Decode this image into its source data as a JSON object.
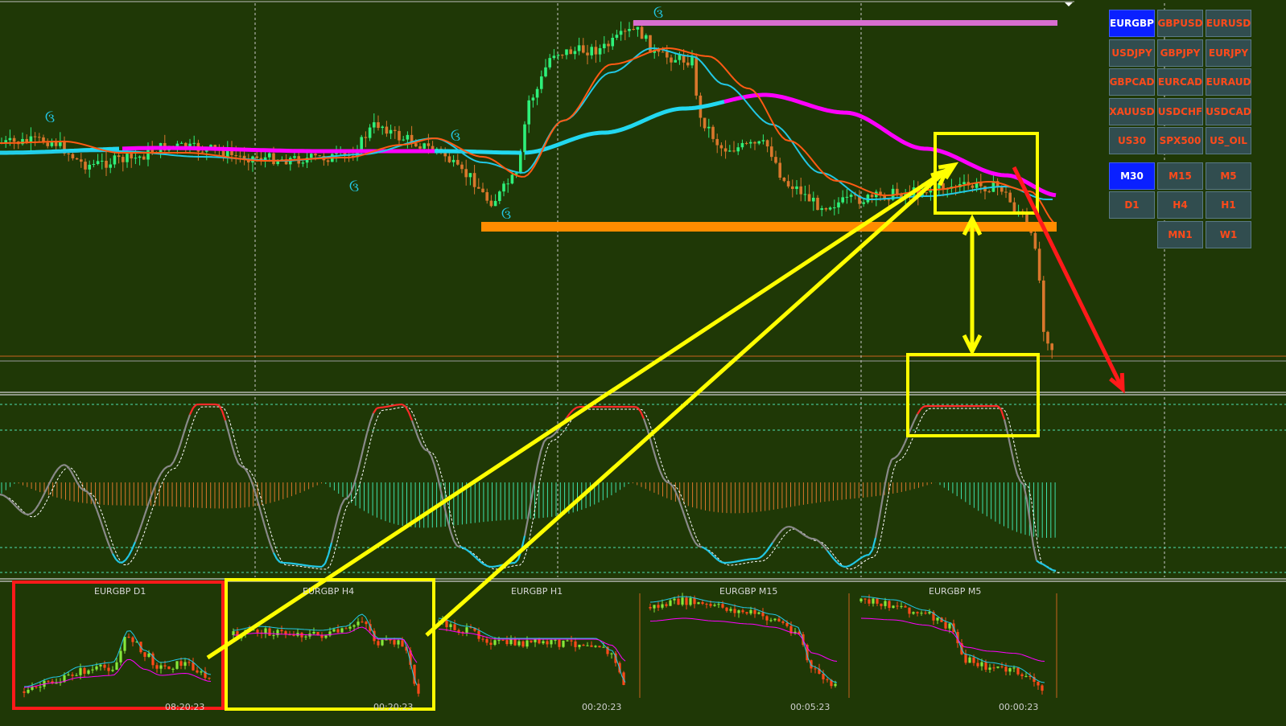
{
  "symbols": [
    "EURGBP",
    "GBPUSD",
    "EURUSD",
    "USDJPY",
    "GBPJPY",
    "EURJPY",
    "GBPCAD",
    "EURCAD",
    "EURAUD",
    "XAUUSD",
    "USDCHF",
    "USDCAD",
    "US30",
    "SPX500",
    "US_OIL"
  ],
  "active_symbol": "EURGBP",
  "timeframes": [
    "M30",
    "M15",
    "M5",
    "D1",
    "H4",
    "H1",
    "MN1",
    "W1"
  ],
  "active_timeframe": "M30",
  "mini_charts": [
    {
      "title": "EURGBP D1",
      "time": "08:20:23"
    },
    {
      "title": "EURGBP H4",
      "time": "00:20:23"
    },
    {
      "title": "EURGBP H1",
      "time": "00:20:23"
    },
    {
      "title": "EURGBP M15",
      "time": "00:05:23"
    },
    {
      "title": "EURGBP M5",
      "time": "00:00:23"
    }
  ],
  "colors": {
    "background": "#1f3806",
    "bull": "#2ef07a",
    "bear": "#d9772c",
    "ema_fast": "#ff5a14",
    "ema_mid": "#22c8e6",
    "ema_slow": "#ff00ff",
    "resistance_line": "#d86ed0",
    "support_line": "#ff8c00",
    "annotation_yellow": "#ffff00",
    "annotation_red": "#ff1a1a"
  },
  "fractal_symbol": "ઉ"
}
